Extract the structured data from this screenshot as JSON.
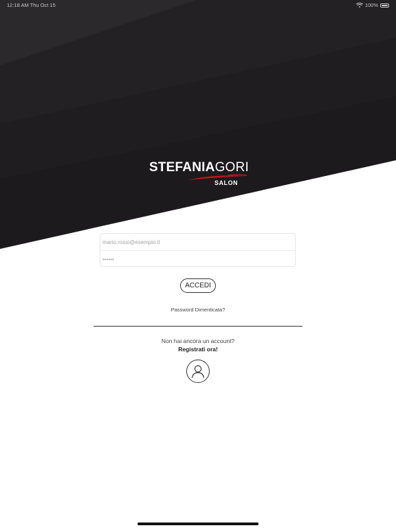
{
  "status_bar": {
    "time": "12:18 AM",
    "date": "Thu Oct 15",
    "battery": "100%",
    "icons": [
      "wifi-icon",
      "battery-icon"
    ]
  },
  "logo": {
    "part1": "STEFANIA",
    "part2": "GORI",
    "sub": "SALON"
  },
  "login": {
    "email_placeholder": "mario.rossi@esempio.it",
    "password_placeholder": "••••••",
    "submit_label": "ACCEDI",
    "forgot_label": "Password Dimenticata?"
  },
  "register": {
    "prompt": "Non hai ancora un account?",
    "link": "Registrati ora!",
    "icon": "user-icon"
  },
  "colors": {
    "hero_dark": "#1e1c1f",
    "accent_red": "#c4161c"
  }
}
